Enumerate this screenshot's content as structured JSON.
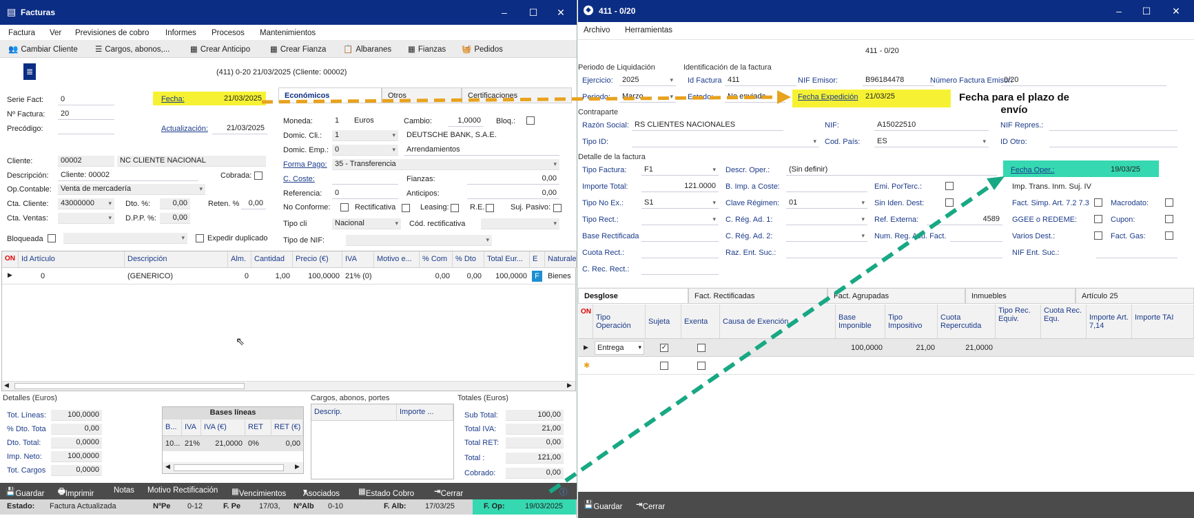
{
  "win1": {
    "title": "Facturas",
    "menu": [
      "Factura",
      "Ver",
      "Previsiones de cobro",
      "Informes",
      "Procesos",
      "Mantenimientos"
    ],
    "toolbar": [
      "Cambiar Cliente",
      "Cargos, abonos,...",
      "Crear Anticipo",
      "Crear Fianza",
      "Albaranes",
      "Fianzas",
      "Pedidos"
    ],
    "header_line": "(411) 0-20  21/03/2025  (Cliente: 00002)",
    "left": {
      "serie_lbl": "Serie Fact:",
      "serie": "0",
      "nfact_lbl": "Nº Factura:",
      "nfact": "20",
      "preco_lbl": "Precódigo:",
      "preco": "",
      "fecha_lbl": "Fecha:",
      "fecha": "21/03/2025",
      "act_lbl": "Actualización:",
      "act": "21/03/2025",
      "cliente_lbl": "Cliente:",
      "cliente": "00002",
      "cliente_name": "NC CLIENTE NACIONAL",
      "desc_lbl": "Descripción:",
      "desc": "Cliente: 00002",
      "cobrada_lbl": "Cobrada:",
      "opc_lbl": "Op.Contable:",
      "opc": "Venta de mercadería",
      "ctacli_lbl": "Cta. Cliente:",
      "ctacli": "43000000",
      "dto_lbl": "Dto. %:",
      "dto": "0,00",
      "reten_lbl": "Reten. %",
      "reten": "0,00",
      "ctaven_lbl": "Cta. Ventas:",
      "ctaven": "",
      "dpp_lbl": "D.P.P. %:",
      "dpp": "0,00",
      "bloq_lbl": "Bloqueada",
      "exp_lbl": "Expedir duplicado"
    },
    "tabs": [
      "Económicos",
      "Otros",
      "Certificaciones"
    ],
    "eco": {
      "moneda_lbl": "Moneda:",
      "moneda_code": "1",
      "moneda": "Euros",
      "cambio_lbl": "Cambio:",
      "cambio": "1,0000",
      "bloq_lbl": "Bloq.:",
      "domcli_lbl": "Domic. Cli.:",
      "domcli": "1",
      "bank": "DEUTSCHE BANK, S.A.E.",
      "domemp_lbl": "Domic. Emp.:",
      "domemp": "0",
      "arr": "Arrendamientos",
      "fpago_lbl": "Forma Pago:",
      "fpago": "35 - Transferencia",
      "coste_lbl": "C. Coste:",
      "fianzas_lbl": "Fianzas:",
      "fianzas": "0,00",
      "ref_lbl": "Referencia:",
      "ref": "0",
      "anticipos_lbl": "Anticipos:",
      "anticipos": "0,00",
      "noconf_lbl": "No Conforme:",
      "rect_lbl": "Rectificativa",
      "leasing_lbl": "Leasing:",
      "re_lbl": "R.E.",
      "suj_lbl": "Suj. Pasivo:",
      "tipocli_lbl": "Tipo cli",
      "tipocli": "Nacional",
      "codrect_lbl": "Cód. rectificativa",
      "tiponif_lbl": "Tipo de NIF:"
    },
    "grid": {
      "on": "ON",
      "headers": [
        "Id Artículo",
        "Descripción",
        "Alm.",
        "Cantidad",
        "Precio (€)",
        "IVA",
        "Motivo e...",
        "% Com",
        "% Dto",
        "Total Eur...",
        "E",
        "Naturale"
      ],
      "row": [
        "0",
        "(GENERICO)",
        "0",
        "1,00",
        "100,0000",
        "21% (0)",
        "",
        "0,00",
        "0,00",
        "100,0000",
        "F",
        "Bienes"
      ]
    },
    "detalles": {
      "title": "Detalles (Euros)",
      "rows": [
        [
          "Tot. Líneas:",
          "100,0000"
        ],
        [
          "% Dto. Tota",
          "0,00"
        ],
        [
          "Dto. Total:",
          "0,0000"
        ],
        [
          "Imp. Neto:",
          "100,0000"
        ],
        [
          "Tot. Cargos",
          "0,0000"
        ]
      ]
    },
    "bases": {
      "title": "Bases líneas",
      "headers": [
        "B...",
        "IVA",
        "IVA (€)",
        "RET",
        "RET (€)"
      ],
      "row": [
        "10...",
        "21%",
        "21,0000",
        "0%",
        "0,00"
      ]
    },
    "cargos": {
      "title": "Cargos, abonos, portes",
      "headers": [
        "Descrip.",
        "Importe ..."
      ]
    },
    "totales": {
      "title": "Totales (Euros)",
      "rows": [
        [
          "Sub Total:",
          "100,00"
        ],
        [
          "Total IVA:",
          "21,00"
        ],
        [
          "Total RET:",
          "0,00"
        ],
        [
          "Total :",
          "121,00"
        ],
        [
          "Cobrado:",
          "0,00"
        ]
      ]
    },
    "bottom": [
      "Guardar",
      "Imprimir",
      "Notas",
      "Motivo Rectificación",
      "Vencimientos",
      "Asociados",
      "Estado Cobro",
      "Cerrar"
    ],
    "status": {
      "estado_lbl": "Estado:",
      "estado": "Factura Actualizada",
      "nped_lbl": "NºPe",
      "nped": "0-12",
      "fped_lbl": "F. Pe",
      "fped": "17/03,",
      "nalb_lbl": "NºAlb",
      "nalb": "0-10",
      "falb_lbl": "F. Alb:",
      "falb": "17/03/25",
      "fop_lbl": "F. Op:",
      "fop": "19/03/2025"
    }
  },
  "win2": {
    "title": "411 - 0/20",
    "menu": [
      "Archivo",
      "Herramientas"
    ],
    "header": "411 - 0/20",
    "periodo_title": "Periodo de Liquidación",
    "ident_title": "Identificación de la factura",
    "ejercicio_lbl": "Ejercicio:",
    "ejercicio": "2025",
    "idfact_lbl": "Id Factura",
    "idfact": "411",
    "nifemi_lbl": "NIF Emisor:",
    "nifemi": "B96184478",
    "numfact_lbl": "Número Factura Emisor:",
    "numfact": "0/20",
    "periodo_lbl": "Periodo:",
    "periodo": "Marzo",
    "estado_lbl": "Estado:",
    "estado": "No enviada",
    "fexp_lbl": "Fecha Expedición",
    "fexp": "21/03/25",
    "callout": "Fecha para el plazo de envío",
    "contra_title": "Contraparte",
    "razon_lbl": "Razón Social:",
    "razon": "RS CLIENTES NACIONALES",
    "nif_lbl": "NIF:",
    "nif": "A15022510",
    "nifrep_lbl": "NIF Repres.:",
    "tipoid_lbl": "Tipo ID:",
    "codpais_lbl": "Cod. País:",
    "codpais": "ES",
    "idotro_lbl": "ID Otro:",
    "detalle_title": "Detalle de la factura",
    "tipofact_lbl": "Tipo Factura:",
    "tipofact": "F1",
    "descop_lbl": "Descr. Oper.:",
    "descop": "(Sin definir)",
    "fop_lbl": "Fecha Oper.:",
    "fop": "19/03/25",
    "imptot_lbl": "Importe Total:",
    "imptot": "121.0000",
    "bimp_lbl": "B. Imp. a Coste:",
    "emipor_lbl": "Emi. PorTerc.:",
    "imptrans_lbl": "Imp. Trans. Inm. Suj. IV",
    "tiponoex_lbl": "Tipo No Ex.:",
    "tiponoex": "S1",
    "clave_lbl": "Clave Régimen:",
    "clave": "01",
    "siniden_lbl": "Sin Iden. Dest:",
    "factsimp_lbl": "Fact. Simp. Art. 7.2 7.3",
    "macro_lbl": "Macrodato:",
    "tiporect_lbl": "Tipo Rect.:",
    "creg1_lbl": "C. Rég. Ad. 1:",
    "refext_lbl": "Ref. Externa:",
    "refext": "4589",
    "ggee_lbl": "GGEE o REDEME:",
    "cupon_lbl": "Cupon:",
    "baserect_lbl": "Base Rectificada",
    "creg2_lbl": "C. Rég. Ad. 2:",
    "numreg_lbl": "Num. Reg. Acu. Fact.",
    "varios_lbl": "Varios Dest.:",
    "factgas_lbl": "Fact. Gas:",
    "cuotarect_lbl": "Cuota Rect.:",
    "razent_lbl": "Raz. Ent. Suc.:",
    "nifent_lbl": "NIF Ent. Suc.:",
    "crec_lbl": "C. Rec. Rect.:",
    "tabs": [
      "Desglose",
      "Fact. Rectificadas",
      "Fact. Agrupadas",
      "Inmuebles",
      "Artículo 25"
    ],
    "grid": {
      "on": "ON",
      "headers": [
        "Tipo Operación",
        "Sujeta",
        "Exenta",
        "Causa de Exención",
        "Base Imponible",
        "Tipo Impositivo",
        "Cuota Repercutida",
        "Tipo Rec. Equiv.",
        "Cuota Rec. Equ.",
        "Importe Art. 7,14",
        "Importe TAI"
      ],
      "row": [
        "Entrega",
        "",
        "",
        "",
        "100,0000",
        "21,00",
        "21,0000",
        "",
        "",
        "",
        ""
      ]
    },
    "bottom": [
      "Guardar",
      "Cerrar"
    ]
  },
  "colors": {
    "title_bar": "#0b2d83",
    "highlight_yellow": "#f6f233",
    "highlight_green": "#35d8b0",
    "arrow_orange": "#e8a21e",
    "arrow_green": "#18a884"
  }
}
